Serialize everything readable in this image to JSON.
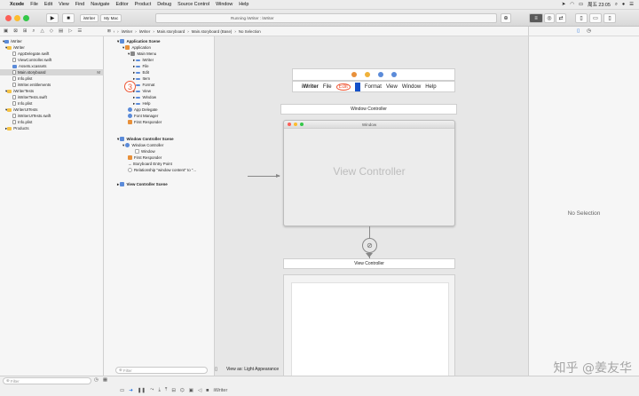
{
  "menubar": {
    "app_name": "Xcode",
    "items": [
      "File",
      "Edit",
      "View",
      "Find",
      "Navigate",
      "Editor",
      "Product",
      "Debug",
      "Source Control",
      "Window",
      "Help"
    ],
    "clock": "周五 23:05"
  },
  "toolbar": {
    "scheme": "iWriter",
    "destination": "My Mac",
    "activity": "Running iWriter : iWriter"
  },
  "jumpbar": {
    "crumbs": [
      "iWriter",
      "iWriter",
      "Main.storyboard",
      "Main.storyboard (Base)",
      "No Selection"
    ]
  },
  "navigator": {
    "items": [
      {
        "label": "iWriter",
        "icon": "blue",
        "badge": ""
      },
      {
        "label": "iWriter",
        "icon": "folder",
        "badge": ""
      },
      {
        "label": "AppDelegate.swift",
        "icon": "file",
        "badge": ""
      },
      {
        "label": "ViewController.swift",
        "icon": "file",
        "badge": ""
      },
      {
        "label": "Assets.xcassets",
        "icon": "blue",
        "badge": ""
      },
      {
        "label": "Main.storyboard",
        "icon": "file",
        "badge": "M"
      },
      {
        "label": "Info.plist",
        "icon": "file",
        "badge": ""
      },
      {
        "label": "iWriter.entitlements",
        "icon": "file",
        "badge": ""
      },
      {
        "label": "iWriterTests",
        "icon": "folder",
        "badge": ""
      },
      {
        "label": "iWriterTests.swift",
        "icon": "file",
        "badge": ""
      },
      {
        "label": "Info.plist",
        "icon": "file",
        "badge": ""
      },
      {
        "label": "iWriterUITests",
        "icon": "folder",
        "badge": ""
      },
      {
        "label": "iWriterUITests.swift",
        "icon": "file",
        "badge": ""
      },
      {
        "label": "Info.plist",
        "icon": "file",
        "badge": ""
      },
      {
        "label": "Products",
        "icon": "folder",
        "badge": ""
      }
    ],
    "filter_placeholder": "Filter"
  },
  "outline": {
    "annotation": "3",
    "items": [
      {
        "label": "Application Scene",
        "bold": true,
        "color": "#5b8bd9"
      },
      {
        "label": "Application",
        "bold": false,
        "color": "#e8903a"
      },
      {
        "label": "Main Menu",
        "bold": false,
        "color": "#888888"
      },
      {
        "label": "iWriter",
        "bold": false,
        "color": "#5b8bd9"
      },
      {
        "label": "File",
        "bold": false,
        "color": "#5b8bd9"
      },
      {
        "label": "Edit",
        "bold": false,
        "color": "#5b8bd9"
      },
      {
        "label": "Item",
        "bold": false,
        "color": "#5b8bd9"
      },
      {
        "label": "Format",
        "bold": false,
        "color": "#5b8bd9"
      },
      {
        "label": "View",
        "bold": false,
        "color": "#5b8bd9"
      },
      {
        "label": "Window",
        "bold": false,
        "color": "#5b8bd9"
      },
      {
        "label": "Help",
        "bold": false,
        "color": "#5b8bd9"
      },
      {
        "label": "App Delegate",
        "bold": false,
        "color": "#5b8bd9"
      },
      {
        "label": "Font Manager",
        "bold": false,
        "color": "#5b8bd9"
      },
      {
        "label": "First Responder",
        "bold": false,
        "color": "#e8903a"
      },
      {
        "label": "Window Controller Scene",
        "bold": true,
        "color": "#5b8bd9"
      },
      {
        "label": "Window Controller",
        "bold": false,
        "color": "#5b8bd9"
      },
      {
        "label": "Window",
        "bold": false,
        "color": "#aaaaaa"
      },
      {
        "label": "First Responder",
        "bold": false,
        "color": "#e8903a"
      },
      {
        "label": "Storyboard Entry Point",
        "bold": false,
        "color": "#555555"
      },
      {
        "label": "Relationship \"window content\" to \"...",
        "bold": false,
        "color": "#aaaaaa"
      },
      {
        "label": "View Controller Scene",
        "bold": true,
        "color": "#5b8bd9"
      }
    ],
    "filter_placeholder": "Filter"
  },
  "canvas": {
    "menu": {
      "app": "iWriter",
      "file": "File",
      "edit": "Edit",
      "format": "Format",
      "view": "View",
      "window": "Window",
      "help": "Help"
    },
    "window_controller_label": "Window Controller",
    "window_title": "Window",
    "view_controller_text": "View Controller",
    "view_controller_label": "View Controller",
    "view_as": "View as: Light Appearance"
  },
  "inspector": {
    "empty_text": "No Selection"
  },
  "bottom": {
    "scheme_label": "iWriter"
  },
  "watermark": "知乎 @姜友华",
  "colors": {
    "close": "#fc5f57",
    "minimize": "#fdbc2e",
    "zoom": "#33c748",
    "accent": "#1450c8",
    "annotation": "#ee5533"
  }
}
